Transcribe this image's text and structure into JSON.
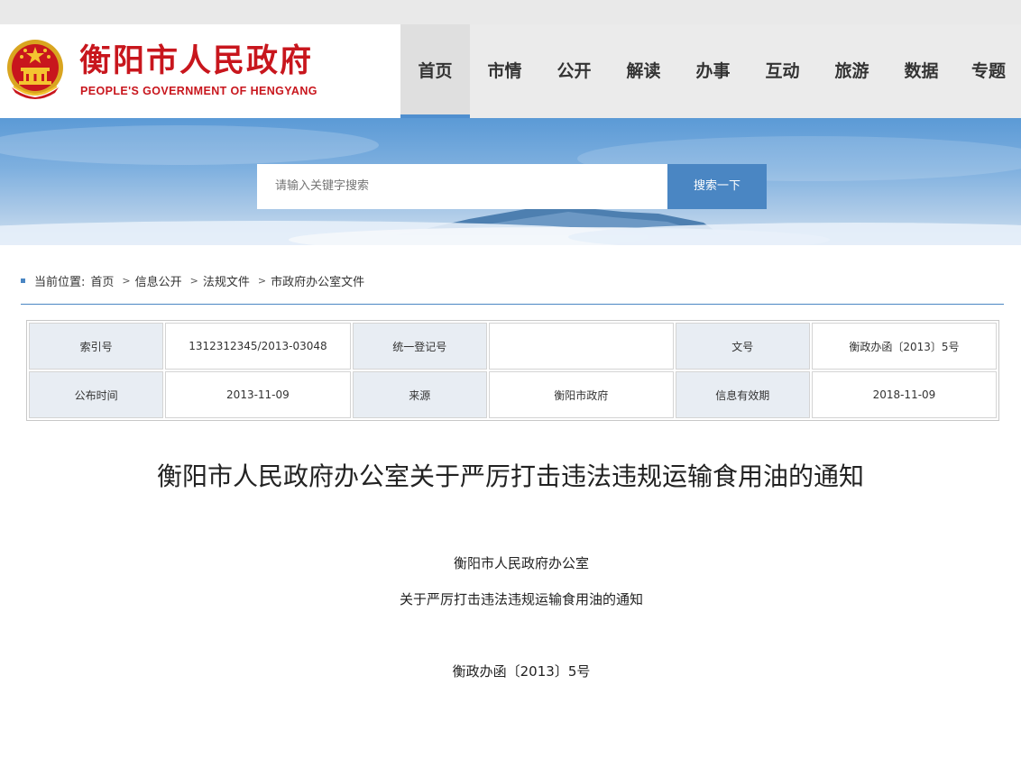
{
  "header": {
    "title": "衡阳市人民政府",
    "subtitle": "PEOPLE'S GOVERNMENT OF HENGYANG",
    "brand_color": "#c8161d",
    "emblem_icon": "national-emblem-icon"
  },
  "nav": {
    "items": [
      {
        "label": "首页",
        "active": true
      },
      {
        "label": "市情"
      },
      {
        "label": "公开"
      },
      {
        "label": "解读"
      },
      {
        "label": "办事"
      },
      {
        "label": "互动"
      },
      {
        "label": "旅游"
      },
      {
        "label": "数据"
      },
      {
        "label": "专题"
      }
    ],
    "accent": "#4f8fcf"
  },
  "search": {
    "placeholder": "请输入关键字搜索",
    "button_label": "搜索一下"
  },
  "breadcrumb": {
    "prefix": "当前位置:",
    "items": [
      "首页",
      "信息公开",
      "法规文件",
      "市政府办公室文件"
    ],
    "separator": ">"
  },
  "info_table": {
    "rows": [
      [
        {
          "label": "索引号",
          "value": "1312312345/2013-03048"
        },
        {
          "label": "统一登记号",
          "value": ""
        },
        {
          "label": "文号",
          "value": "衡政办函〔2013〕5号"
        }
      ],
      [
        {
          "label": "公布时间",
          "value": "2013-11-09"
        },
        {
          "label": "来源",
          "value": "衡阳市政府"
        },
        {
          "label": "信息有效期",
          "value": "2018-11-09"
        }
      ]
    ]
  },
  "document": {
    "title": "衡阳市人民政府办公室关于严厉打击违法违规运输食用油的通知",
    "issuer": "衡阳市人民政府办公室",
    "subject": "关于严厉打击违法违规运输食用油的通知",
    "doc_number": "衡政办函〔2013〕5号"
  }
}
